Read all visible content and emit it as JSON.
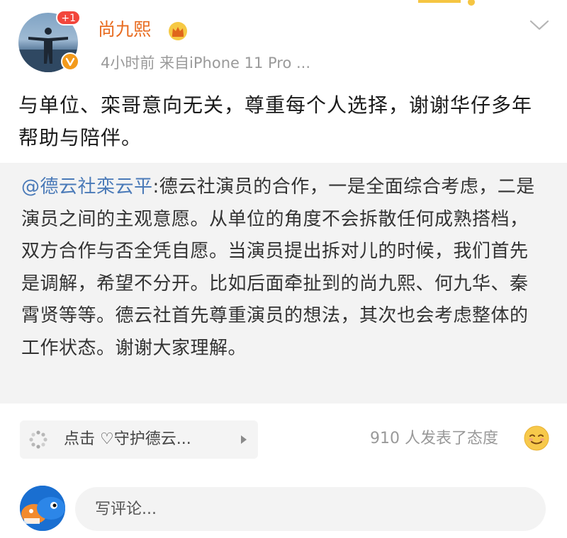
{
  "header": {
    "username": "尚九熙",
    "notification_badge": "+1",
    "meta": "4小时前  来自iPhone 11 Pro ...",
    "verified_color": "#f39a1b",
    "username_color": "#e86b1f"
  },
  "post": {
    "text": "与单位、栾哥意向无关，尊重每个人选择，谢谢华仔多年帮助与陪伴。"
  },
  "repost": {
    "mention": "@德云社栾云平",
    "text": ":德云社演员的合作，一是全面综合考虑，二是演员之间的主观意愿。从单位的角度不会拆散任何成熟搭档，双方合作与否全凭自愿。当演员提出拆对儿的时候，我们首先是调解，希望不分开。比如后面牵扯到的尚九熙、何九华、秦霄贤等等。德云社首先尊重演员的想法，其次也会考虑整体的工作状态。谢谢大家理解。",
    "mention_color": "#4a7ab8"
  },
  "footer": {
    "guard_prefix": "点击",
    "guard_heart": "♡",
    "guard_label": "守护德云...",
    "attitude_text": "910 人发表了态度"
  },
  "comment": {
    "placeholder": "写评论..."
  },
  "icons": {
    "more": "chevron-down-icon",
    "crown": "crown-icon",
    "verified": "verified-v-icon",
    "spinner": "loading-dots-icon",
    "emoji": "smile-emoji-icon"
  }
}
